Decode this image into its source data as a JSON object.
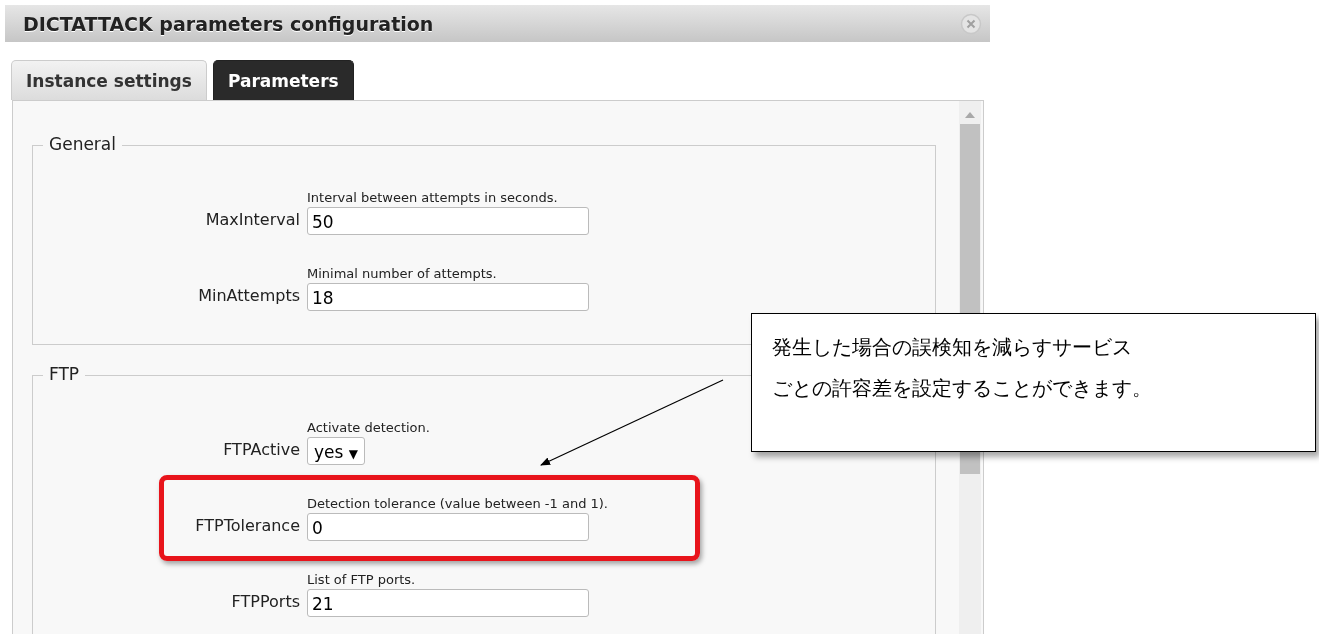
{
  "window": {
    "title": "DICTATTACK parameters configuration"
  },
  "tabs": [
    {
      "label": "Instance settings",
      "selected": false
    },
    {
      "label": "Parameters",
      "selected": true
    }
  ],
  "sections": [
    {
      "title": "General",
      "fields": [
        {
          "kind": "text",
          "label": "MaxInterval",
          "hint": "Interval between attempts in seconds.",
          "value": "50",
          "highlighted": false
        },
        {
          "kind": "text",
          "label": "MinAttempts",
          "hint": "Minimal number of attempts.",
          "value": "18",
          "highlighted": false
        }
      ]
    },
    {
      "title": "FTP",
      "fields": [
        {
          "kind": "select",
          "label": "FTPActive",
          "hint": "Activate detection.",
          "value": "yes",
          "caret": "▼",
          "highlighted": false
        },
        {
          "kind": "text",
          "label": "FTPTolerance",
          "hint": "Detection tolerance (value between -1 and 1).",
          "value": "0",
          "highlighted": true
        },
        {
          "kind": "text",
          "label": "FTPPorts",
          "hint": "List of FTP ports.",
          "value": "21",
          "highlighted": false
        }
      ]
    }
  ],
  "callout": {
    "lines": [
      "発生した場合の誤検知を減らすサービス",
      "ごとの許容差を設定することができます。"
    ]
  }
}
